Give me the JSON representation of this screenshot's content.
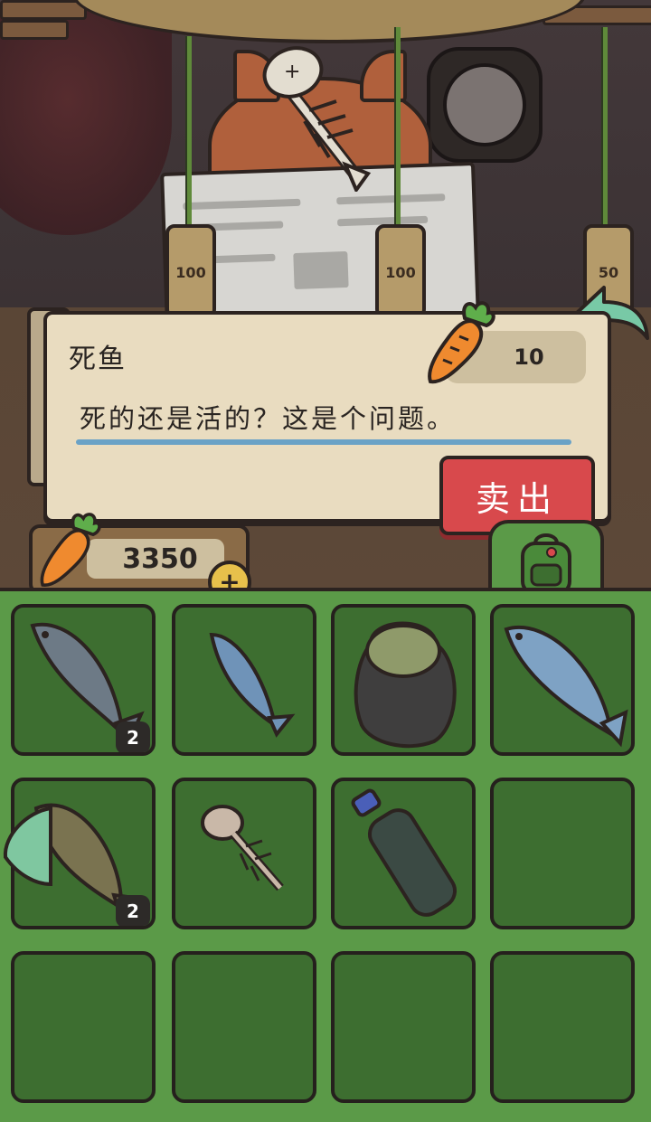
{
  "shop": {
    "price_tags": [
      "100",
      "100",
      "50"
    ]
  },
  "item_detail": {
    "name": "死鱼",
    "price": "10",
    "price_icon": "carrot-icon",
    "description": "死的还是活的？这是个问题。",
    "sell_label": "卖出"
  },
  "wallet": {
    "carrots": "3350",
    "add_icon": "plus-icon"
  },
  "inventory": {
    "tab_icon": "backpack-icon",
    "slots": [
      {
        "item": "fish-icon",
        "count": "2"
      },
      {
        "item": "small-fish-icon",
        "count": ""
      },
      {
        "item": "trash-bag-icon",
        "count": ""
      },
      {
        "item": "salmon-icon",
        "count": ""
      },
      {
        "item": "catfish-icon",
        "count": "2"
      },
      {
        "item": "fish-bone-icon",
        "count": ""
      },
      {
        "item": "plastic-bottle-icon",
        "count": ""
      },
      {
        "item": "",
        "count": ""
      },
      {
        "item": "",
        "count": ""
      },
      {
        "item": "",
        "count": ""
      },
      {
        "item": "",
        "count": ""
      },
      {
        "item": "",
        "count": ""
      }
    ]
  },
  "colors": {
    "sell_button": "#d8494c",
    "inventory_bg": "#5b9a48",
    "slot_bg": "#3d6e30",
    "panel_bg": "#e9dcc0"
  }
}
